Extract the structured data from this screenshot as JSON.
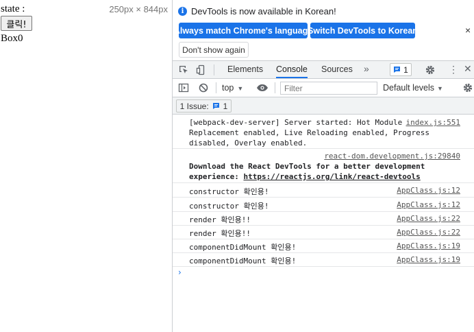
{
  "page": {
    "state_label": "state :",
    "viewport_size": "250px × 844px",
    "button_label": "클릭!",
    "box_text": "Box0"
  },
  "devtools": {
    "infobar": {
      "message": "DevTools is now available in Korean!",
      "match_language_label": "Always match Chrome's language",
      "switch_language_label": "Switch DevTools to Korean",
      "dont_show_label": "Don't show again",
      "close_icon": "×"
    },
    "tabs": {
      "elements": "Elements",
      "console": "Console",
      "sources": "Sources",
      "more": "»",
      "issues_count": "1",
      "menu": "⋮",
      "close": "✕"
    },
    "toolbar": {
      "context": "top",
      "filter_placeholder": "Filter",
      "levels": "Default levels"
    },
    "issue_bar": {
      "label": "1 Issue:",
      "count": "1"
    },
    "console_messages": [
      {
        "lines": [
          "[webpack-dev-server] Server started: Hot Module",
          "Replacement enabled, Live Reloading enabled, Progress",
          "disabled, Overlay enabled."
        ],
        "source": "index.js:551"
      },
      {
        "source": "react-dom.development.js:29840",
        "line1": "Download the React DevTools for a better development",
        "line2_prefix": "experience: ",
        "line2_link": "https://reactjs.org/link/react-devtools"
      },
      {
        "text": "constructor 확인용!",
        "source": "AppClass.js:12"
      },
      {
        "text": "constructor 확인용!",
        "source": "AppClass.js:12"
      },
      {
        "text": "render 확인용!!",
        "source": "AppClass.js:22"
      },
      {
        "text": "render 확인용!!",
        "source": "AppClass.js:22"
      },
      {
        "text": "componentDidMount 확인용!",
        "source": "AppClass.js:19"
      },
      {
        "text": "componentDidMount 확인용!",
        "source": "AppClass.js:19"
      }
    ],
    "prompt": "›"
  },
  "colors": {
    "accent": "#1a73e8",
    "toolbar_bg": "#f1f3f4",
    "divider": "#cacdd1"
  }
}
